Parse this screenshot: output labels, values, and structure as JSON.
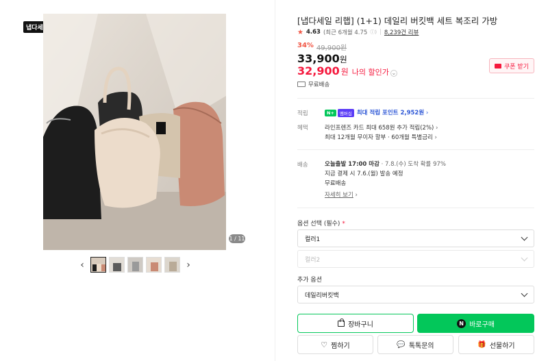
{
  "gallery": {
    "badge": "냅다세일",
    "counter": "1 / 11",
    "prev": "‹",
    "next": "›"
  },
  "product": {
    "title": "[냅다세일 리햅] (1+1) 데일리 버킷백 세트 복조리 가방",
    "rating": "4.63",
    "rating_recent": "(최근 6개월 4.75",
    "review_count": "8,239건 리뷰",
    "discount_rate": "34%",
    "original_price": "49,900원",
    "price": "33,900",
    "price_unit": "원",
    "my_price": "32,900",
    "my_price_unit": "원",
    "my_price_label": "나의 할인가",
    "coupon": "쿠폰 받기",
    "free_shipping": "무료배송"
  },
  "benefits": {
    "points_label": "적립",
    "points_badge1": "N+",
    "points_badge2": "멤버십",
    "points_text": "최대 적립 포인트 2,952원",
    "perks_label": "혜택",
    "perks_line1": "라인프렌즈 카드 최대 658원 추가 적립(2%)",
    "perks_line2": "최대 12개월 무이자 할부 · 60개월 특별금리"
  },
  "delivery": {
    "label": "배송",
    "line1_bold": "오늘출발 17:00 마감",
    "line1_rest": "· 7.8.(수) 도착 확률 97%",
    "line2": "지금 결제 시 7.6.(월) 발송 예정",
    "line3": "무료배송",
    "detail_link": "자세히 보기"
  },
  "options": {
    "required_label": "옵션 선택 (필수)",
    "required_mark": "*",
    "color1": "컬러1",
    "color2": "컬러2",
    "extra_label": "추가 옵션",
    "extra_value": "데일리버킷백"
  },
  "actions": {
    "cart": "장바구니",
    "buy": "바로구매",
    "buy_icon": "N",
    "wish": "찜하기",
    "talk": "톡톡문의",
    "gift": "선물하기"
  },
  "colors": {
    "naver_green": "#03c75a",
    "sale_red": "#f5183d",
    "discount_red": "#f15746",
    "point_blue": "#2c56d6"
  },
  "icons": [
    "star-icon",
    "info-icon",
    "truck-icon",
    "chevron-down-icon",
    "coupon-icon",
    "bag-icon",
    "heart-icon",
    "chat-icon",
    "gift-icon",
    "naver-n-icon"
  ]
}
